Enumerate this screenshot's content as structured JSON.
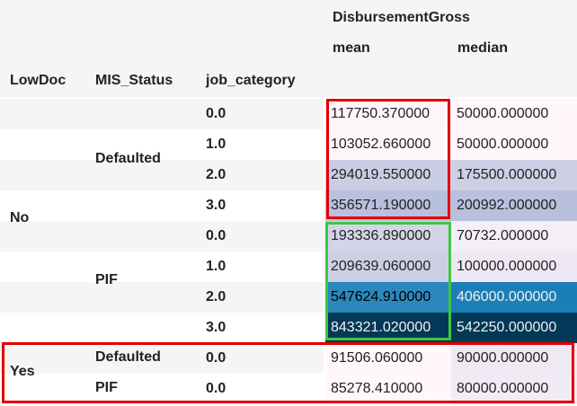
{
  "table": {
    "column_group": "DisbursementGross",
    "stat_headers": [
      "mean",
      "median"
    ],
    "index_headers": [
      "LowDoc",
      "MIS_Status",
      "job_category"
    ],
    "lowdoc_values": [
      "No",
      "Yes"
    ],
    "status_labels": {
      "no_defaulted": "Defaulted",
      "no_pif": "PIF",
      "yes_defaulted": "Defaulted",
      "yes_pif": "PIF"
    },
    "rows": [
      {
        "job": "0.0",
        "mean": "117750.370000",
        "median": "50000.000000"
      },
      {
        "job": "1.0",
        "mean": "103052.660000",
        "median": "50000.000000"
      },
      {
        "job": "2.0",
        "mean": "294019.550000",
        "median": "175500.000000"
      },
      {
        "job": "3.0",
        "mean": "356571.190000",
        "median": "200992.000000"
      },
      {
        "job": "0.0",
        "mean": "193336.890000",
        "median": "70732.000000"
      },
      {
        "job": "1.0",
        "mean": "209639.060000",
        "median": "100000.000000"
      },
      {
        "job": "2.0",
        "mean": "547624.910000",
        "median": "406000.000000"
      },
      {
        "job": "3.0",
        "mean": "843321.020000",
        "median": "542250.000000"
      },
      {
        "job": "0.0",
        "mean": "91506.060000",
        "median": "90000.000000"
      },
      {
        "job": "0.0",
        "mean": "85278.410000",
        "median": "80000.000000"
      }
    ],
    "mean_colors": [
      "#fdf5fa",
      "#fff7fb",
      "#cbcde4",
      "#b8c0de",
      "#d3d4e7",
      "#cdd0e5",
      "#2a88bc",
      "#023858",
      "#fff7fb",
      "#fff7fb"
    ],
    "median_colors": [
      "#fff7fb",
      "#fff7fb",
      "#cdd0e5",
      "#b8c0de",
      "#f4eef6",
      "#ede8f3",
      "#1b7eb7",
      "#023858",
      "#efe9f3",
      "#f1ebf5"
    ],
    "mean_text_colors": [
      "#222222",
      "#222222",
      "#222222",
      "#222222",
      "#222222",
      "#222222",
      "#000000",
      "#f1f1f1",
      "#222222",
      "#222222"
    ],
    "median_text_colors": [
      "#222222",
      "#222222",
      "#222222",
      "#222222",
      "#222222",
      "#222222",
      "#f1f1f1",
      "#f1f1f1",
      "#222222",
      "#222222"
    ]
  },
  "highlights": {
    "colors": {
      "red": "#e00000",
      "green": "#3fc63f"
    }
  }
}
